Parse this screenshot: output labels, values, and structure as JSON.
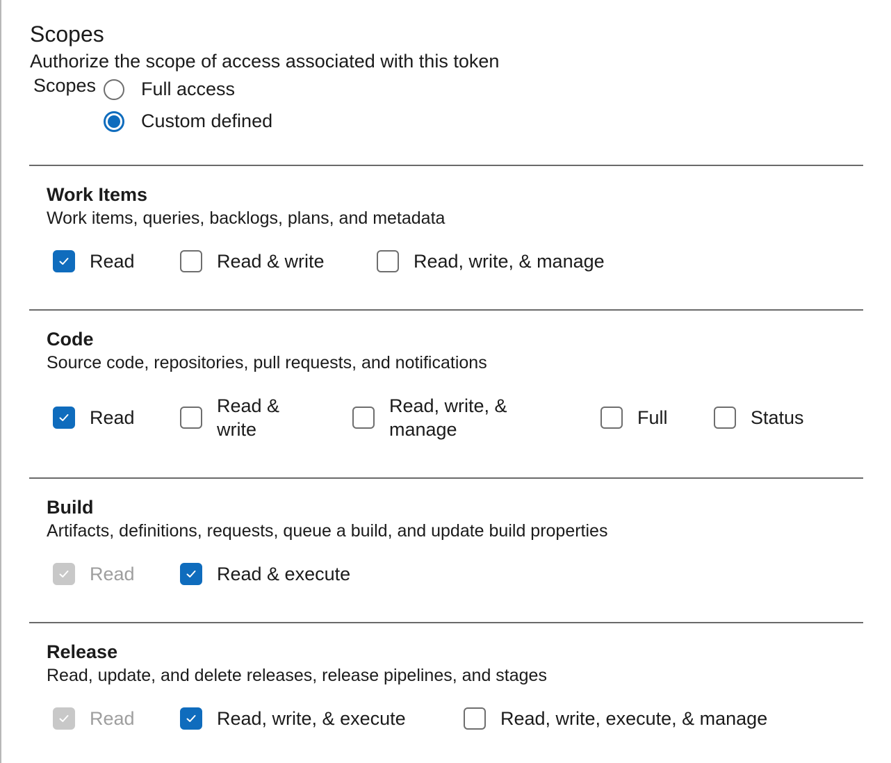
{
  "header": {
    "title": "Scopes",
    "subtitle": "Authorize the scope of access associated with this token"
  },
  "scope_selector": {
    "label": "Scopes",
    "options": [
      {
        "label": "Full access",
        "selected": false
      },
      {
        "label": "Custom defined",
        "selected": true
      }
    ]
  },
  "colors": {
    "accent": "#0f6cbd",
    "disabled": "#c8c8c8",
    "border": "#6e6e6e",
    "divider": "#6a6a6a"
  },
  "sections": [
    {
      "title": "Work Items",
      "description": "Work items, queries, backlogs, plans, and metadata",
      "options": [
        {
          "label": "Read",
          "checked": true,
          "disabled": false
        },
        {
          "label": "Read & write",
          "checked": false,
          "disabled": false
        },
        {
          "label": "Read, write, & manage",
          "checked": false,
          "disabled": false
        }
      ]
    },
    {
      "title": "Code",
      "description": "Source code, repositories, pull requests, and notifications",
      "options": [
        {
          "label": "Read",
          "checked": true,
          "disabled": false
        },
        {
          "label": "Read & write",
          "checked": false,
          "disabled": false
        },
        {
          "label": "Read, write, & manage",
          "checked": false,
          "disabled": false
        },
        {
          "label": "Full",
          "checked": false,
          "disabled": false
        },
        {
          "label": "Status",
          "checked": false,
          "disabled": false
        }
      ]
    },
    {
      "title": "Build",
      "description": "Artifacts, definitions, requests, queue a build, and update build properties",
      "options": [
        {
          "label": "Read",
          "checked": true,
          "disabled": true
        },
        {
          "label": "Read & execute",
          "checked": true,
          "disabled": false
        }
      ]
    },
    {
      "title": "Release",
      "description": "Read, update, and delete releases, release pipelines, and stages",
      "options": [
        {
          "label": "Read",
          "checked": true,
          "disabled": true
        },
        {
          "label": "Read, write, & execute",
          "checked": true,
          "disabled": false
        },
        {
          "label": "Read, write, execute, & manage",
          "checked": false,
          "disabled": false
        }
      ]
    }
  ]
}
